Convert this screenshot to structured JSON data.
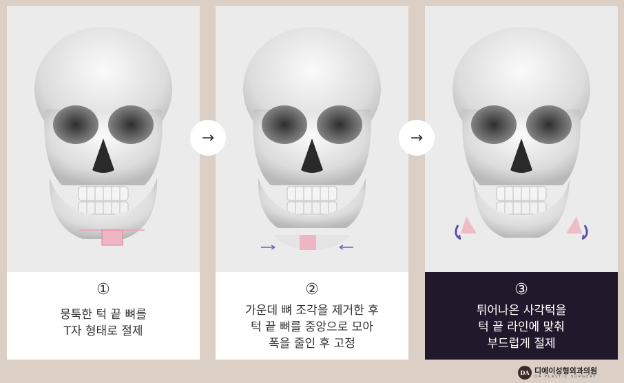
{
  "steps": [
    {
      "number": "①",
      "lines": [
        "뭉툭한 턱 끝 뼈를",
        "T자 형태로 절제"
      ]
    },
    {
      "number": "②",
      "lines": [
        "가운데 뼈 조각을 제거한 후",
        "턱 끝 뼈를 중앙으로 모아",
        "폭을 줄인 후 고정"
      ]
    },
    {
      "number": "③",
      "lines": [
        "튀어나온 사각턱을",
        "턱 끝 라인에 맞춰",
        "부드럽게 절제"
      ]
    }
  ],
  "arrows": [
    "→",
    "→"
  ],
  "brand": {
    "logo": "DA",
    "name": "디에이성형외과의원",
    "subtitle": "DA PLASTIC SURGERY"
  },
  "colors": {
    "background": "#dccfc6",
    "highlight_panel": "#22182b",
    "cut_mark": "#e8a0b0",
    "direction_arrow": "#6a5fb0"
  },
  "icons": [
    "skull-illustration",
    "right-arrow-icon",
    "curved-arrow-icon"
  ]
}
